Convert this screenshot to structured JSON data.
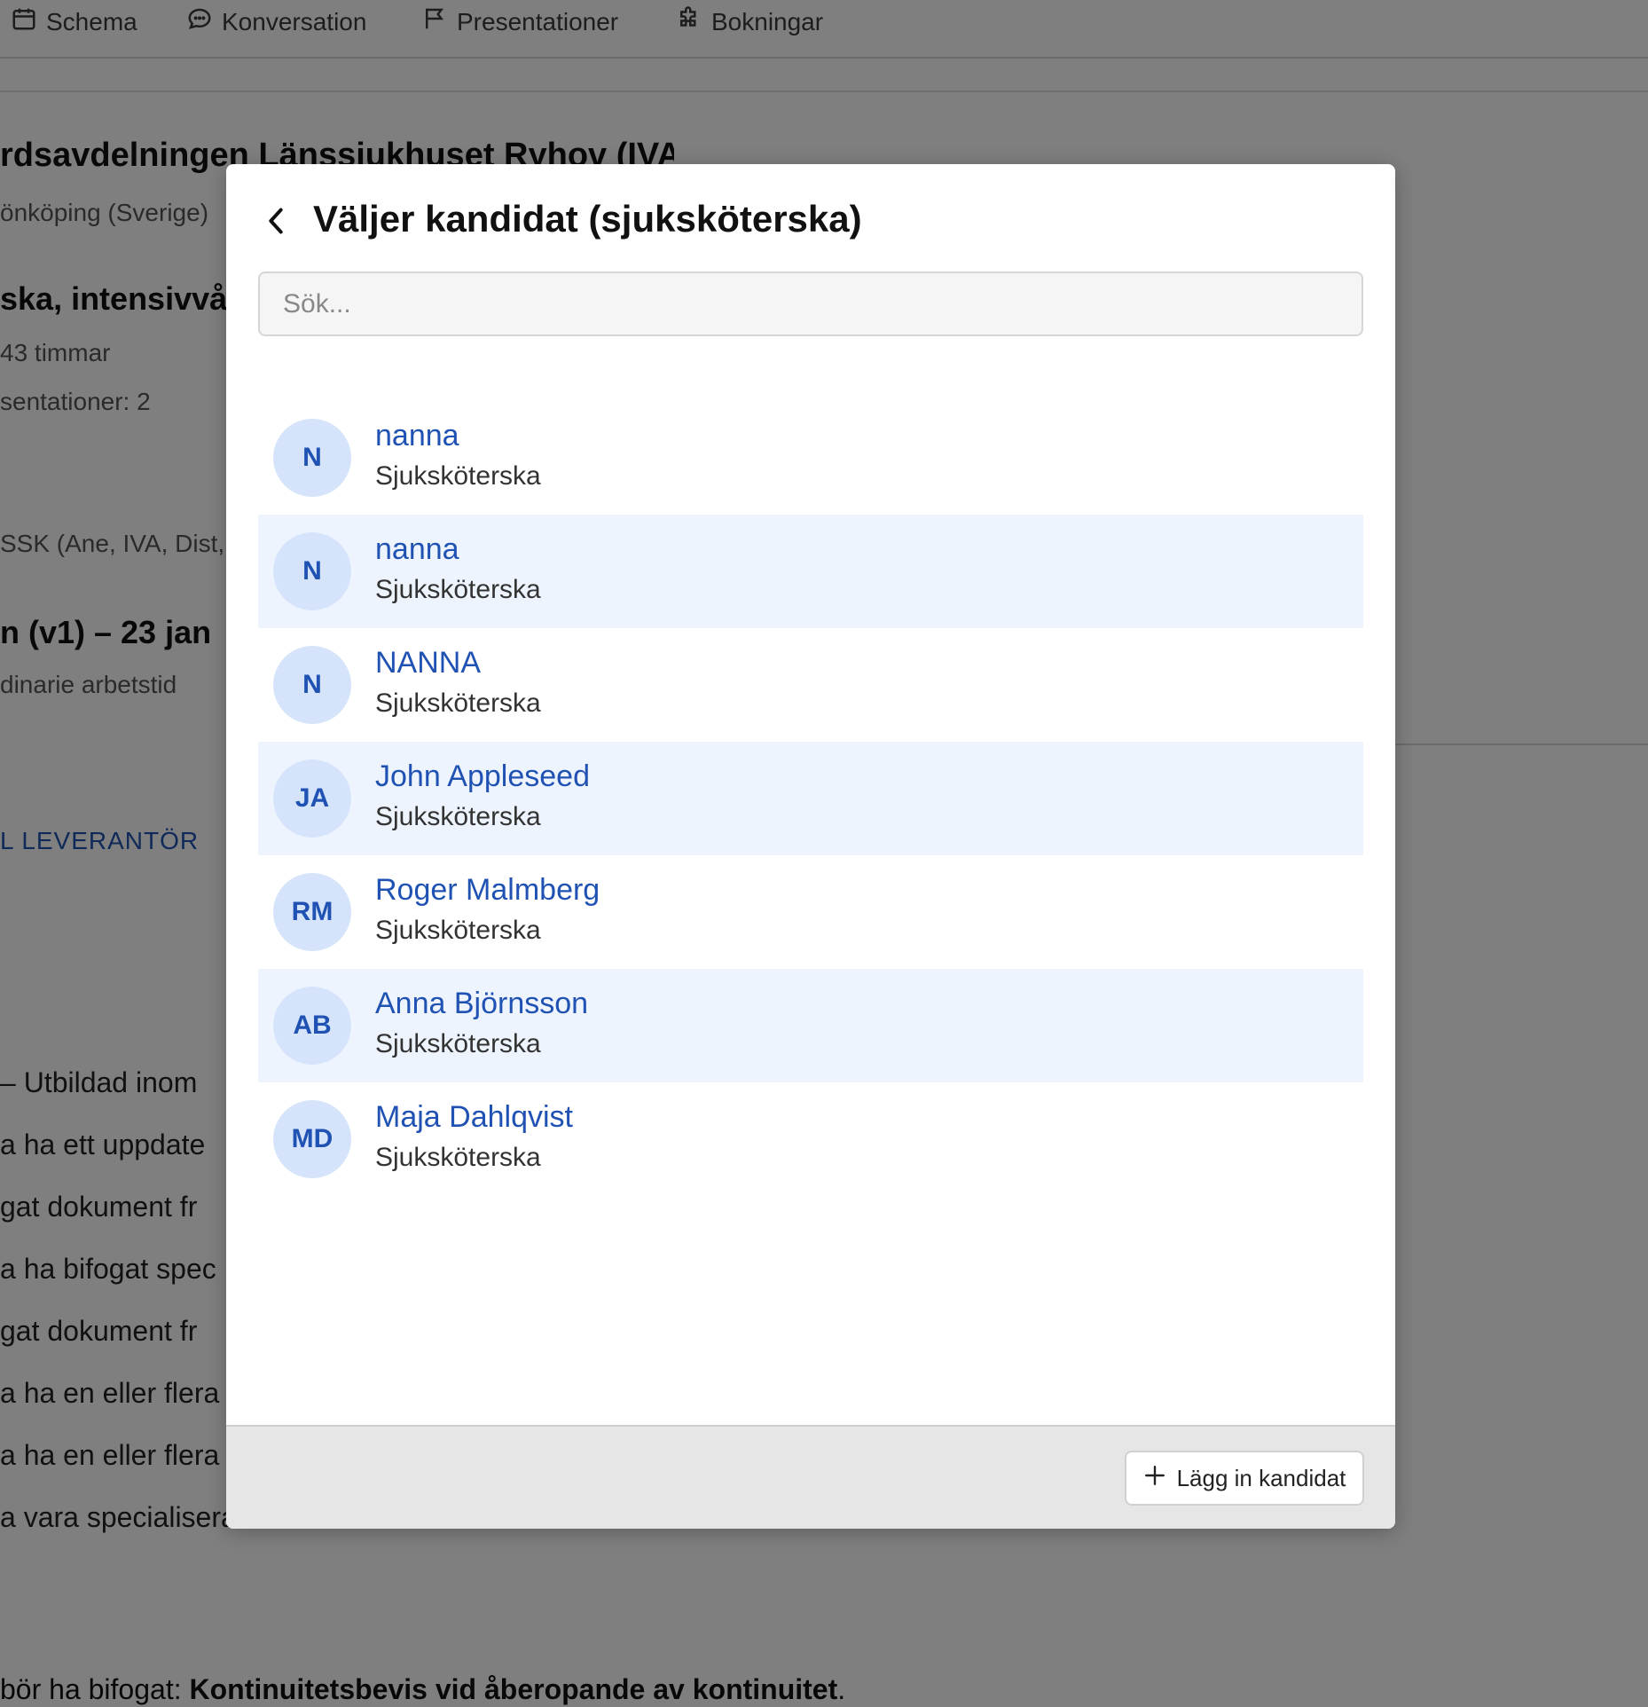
{
  "nav": {
    "items": [
      {
        "label": "Schema",
        "icon": "calendar-icon"
      },
      {
        "label": "Konversation",
        "icon": "chat-bubble-icon"
      },
      {
        "label": "Presentationer",
        "icon": "flag-icon"
      },
      {
        "label": "Bokningar",
        "icon": "puzzle-icon"
      }
    ]
  },
  "background": {
    "title": "rdsavdelningen Länssjukhuset Ryhov (IVA)",
    "location": "önköping (Sverige)",
    "role_heading": "ska, intensivvå",
    "hours": "43 timmar",
    "presentations": "sentationer: 2",
    "specialties": "SSK (Ane, IVA, Dist,",
    "period": "n (v1) – 23 jan",
    "worktime": "dinarie arbetstid",
    "supplier_link": "L LEVERANTÖR",
    "req_lines": [
      "– Utbildad inom",
      "a ha ett uppdate",
      "gat dokument fr",
      "a ha bifogat spec",
      "gat dokument fr",
      "a ha en eller flera",
      "a ha en eller flera",
      "a vara specialiserad inom Medicin Vård."
    ],
    "bottom_prefix": " bör ha bifogat: ",
    "bottom_bold": "Kontinuitetsbevis vid åberopande av kontinuitet",
    "bottom_suffix": "."
  },
  "modal": {
    "title": "Väljer kandidat (sjuksköterska)",
    "search_placeholder": "Sök...",
    "add_button_label": "Lägg in kandidat",
    "candidates": [
      {
        "initials": "N",
        "name": "nanna",
        "role": "Sjuksköterska"
      },
      {
        "initials": "N",
        "name": "nanna",
        "role": "Sjuksköterska"
      },
      {
        "initials": "N",
        "name": "NANNA",
        "role": "Sjuksköterska"
      },
      {
        "initials": "JA",
        "name": "John Appleseed",
        "role": "Sjuksköterska"
      },
      {
        "initials": "RM",
        "name": "Roger Malmberg",
        "role": "Sjuksköterska"
      },
      {
        "initials": "AB",
        "name": "Anna Björnsson",
        "role": "Sjuksköterska"
      },
      {
        "initials": "MD",
        "name": "Maja Dahlqvist",
        "role": "Sjuksköterska"
      }
    ]
  },
  "colors": {
    "accent": "#1f52b3",
    "avatar_bg": "#d6e4fb",
    "row_alt_bg": "#eef4fe",
    "overlay": "rgba(0,0,0,0.5)"
  }
}
